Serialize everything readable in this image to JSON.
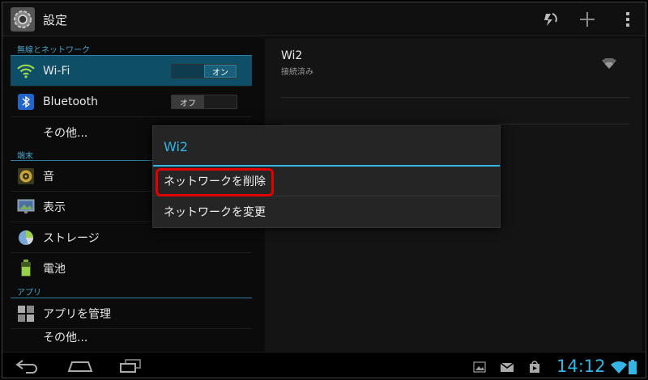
{
  "action_bar": {
    "title": "設定",
    "app_icon": "settings-gear-icon",
    "actions": [
      "sync-icon",
      "add-icon",
      "overflow-menu-icon"
    ]
  },
  "left_panel": {
    "sections": [
      {
        "header": "無線とネットワーク",
        "items": [
          {
            "label": "Wi-Fi",
            "icon": "wifi-icon",
            "selected": true,
            "switch": {
              "on": "オン",
              "off": "",
              "state": "on"
            }
          },
          {
            "label": "Bluetooth",
            "icon": "bluetooth-icon",
            "switch": {
              "on": "",
              "off": "オフ",
              "state": "off"
            }
          },
          {
            "label": "その他...",
            "indent": true
          }
        ]
      },
      {
        "header": "端末",
        "items": [
          {
            "label": "音",
            "icon": "speaker-icon"
          },
          {
            "label": "表示",
            "icon": "display-icon"
          },
          {
            "label": "ストレージ",
            "icon": "storage-pie-icon"
          },
          {
            "label": "電池",
            "icon": "battery-icon"
          }
        ]
      },
      {
        "header": "アプリ",
        "items": [
          {
            "label": "アプリを管理",
            "icon": "apps-grid-icon"
          },
          {
            "label": "その他..."
          }
        ]
      }
    ]
  },
  "right_panel": {
    "network": {
      "name": "Wi2",
      "status": "接続済み"
    }
  },
  "dialog": {
    "title": "Wi2",
    "items": [
      "ネットワークを削除",
      "ネットワークを変更"
    ]
  },
  "status_bar": {
    "time": "14:12"
  },
  "colors": {
    "accent": "#33b5e5",
    "selected_bg": "#0e4e66",
    "highlight": "#e30000"
  }
}
